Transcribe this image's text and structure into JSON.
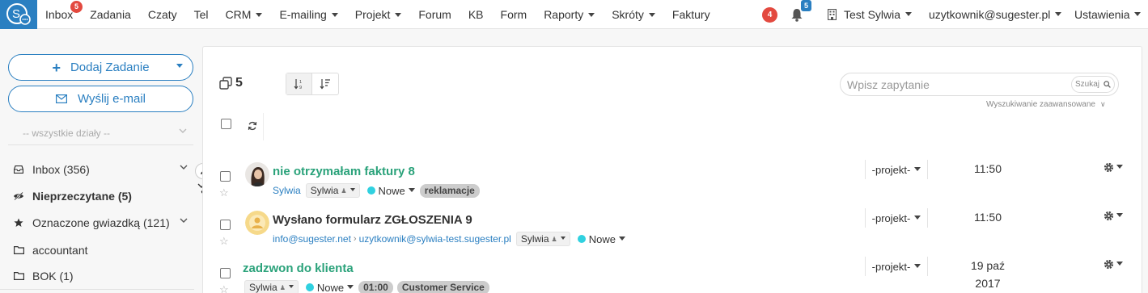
{
  "nav": {
    "items": [
      {
        "label": "Inbox",
        "badge": "5"
      },
      {
        "label": "Zadania"
      },
      {
        "label": "Czaty"
      },
      {
        "label": "Tel"
      },
      {
        "label": "CRM",
        "dropdown": true
      },
      {
        "label": "E-mailing",
        "dropdown": true
      },
      {
        "label": "Projekt",
        "dropdown": true
      },
      {
        "label": "Forum"
      },
      {
        "label": "KB"
      },
      {
        "label": "Form"
      },
      {
        "label": "Raporty",
        "dropdown": true
      },
      {
        "label": "Skróty",
        "dropdown": true
      },
      {
        "label": "Faktury"
      }
    ],
    "right": {
      "red_badge": "4",
      "bell_badge": "5",
      "account_name": "Test Sylwia",
      "user_email": "uzytkownik@sugester.pl",
      "settings_label": "Ustawienia"
    }
  },
  "sidebar": {
    "add_task_label": "Dodaj Zadanie",
    "send_email_label": "Wyślij e-mail",
    "department_select": "-- wszystkie działy --",
    "items": [
      {
        "label": "Inbox (356)",
        "icon": "inbox-icon",
        "expandable": true
      },
      {
        "label": "Nieprzeczytane (5)",
        "icon": "eye-slash-icon",
        "bold": true
      },
      {
        "label": "Oznaczone gwiazdką (121)",
        "icon": "star-icon",
        "expandable": true
      },
      {
        "label": "accountant",
        "icon": "folder-icon"
      },
      {
        "label": "BOK (1)",
        "icon": "folder-icon"
      }
    ]
  },
  "main": {
    "count": "5",
    "search": {
      "placeholder": "Wpisz zapytanie",
      "button_label": "Szukaj",
      "advanced_label": "Wyszukiwanie zaawansowane"
    },
    "project_filter_label": "-projekt-",
    "rows": [
      {
        "title": "nie otrzymałam faktury 8",
        "sender": "Sylwia",
        "assignee": "Sylwia",
        "status": "Nowe",
        "tags": [
          "reklamacje"
        ],
        "time": "11:50"
      },
      {
        "title": "Wysłano formularz ZGŁOSZENIA 9",
        "sender": "info@sugester.net",
        "recipient": "uzytkownik@sylwia-test.sugester.pl",
        "assignee": "Sylwia",
        "status": "Nowe",
        "tags": [],
        "time": "11:50"
      },
      {
        "title": "zadzwon do klienta",
        "assignee": "Sylwia",
        "status": "Nowe",
        "duration": "01:00",
        "tags": [
          "Customer Service"
        ],
        "date": "19 paź",
        "year": "2017"
      }
    ]
  },
  "colors": {
    "brand": "#2a7fc1",
    "title_green": "#2aa27a",
    "badge_red": "#e3493f",
    "status_dot": "#30d1e0"
  }
}
